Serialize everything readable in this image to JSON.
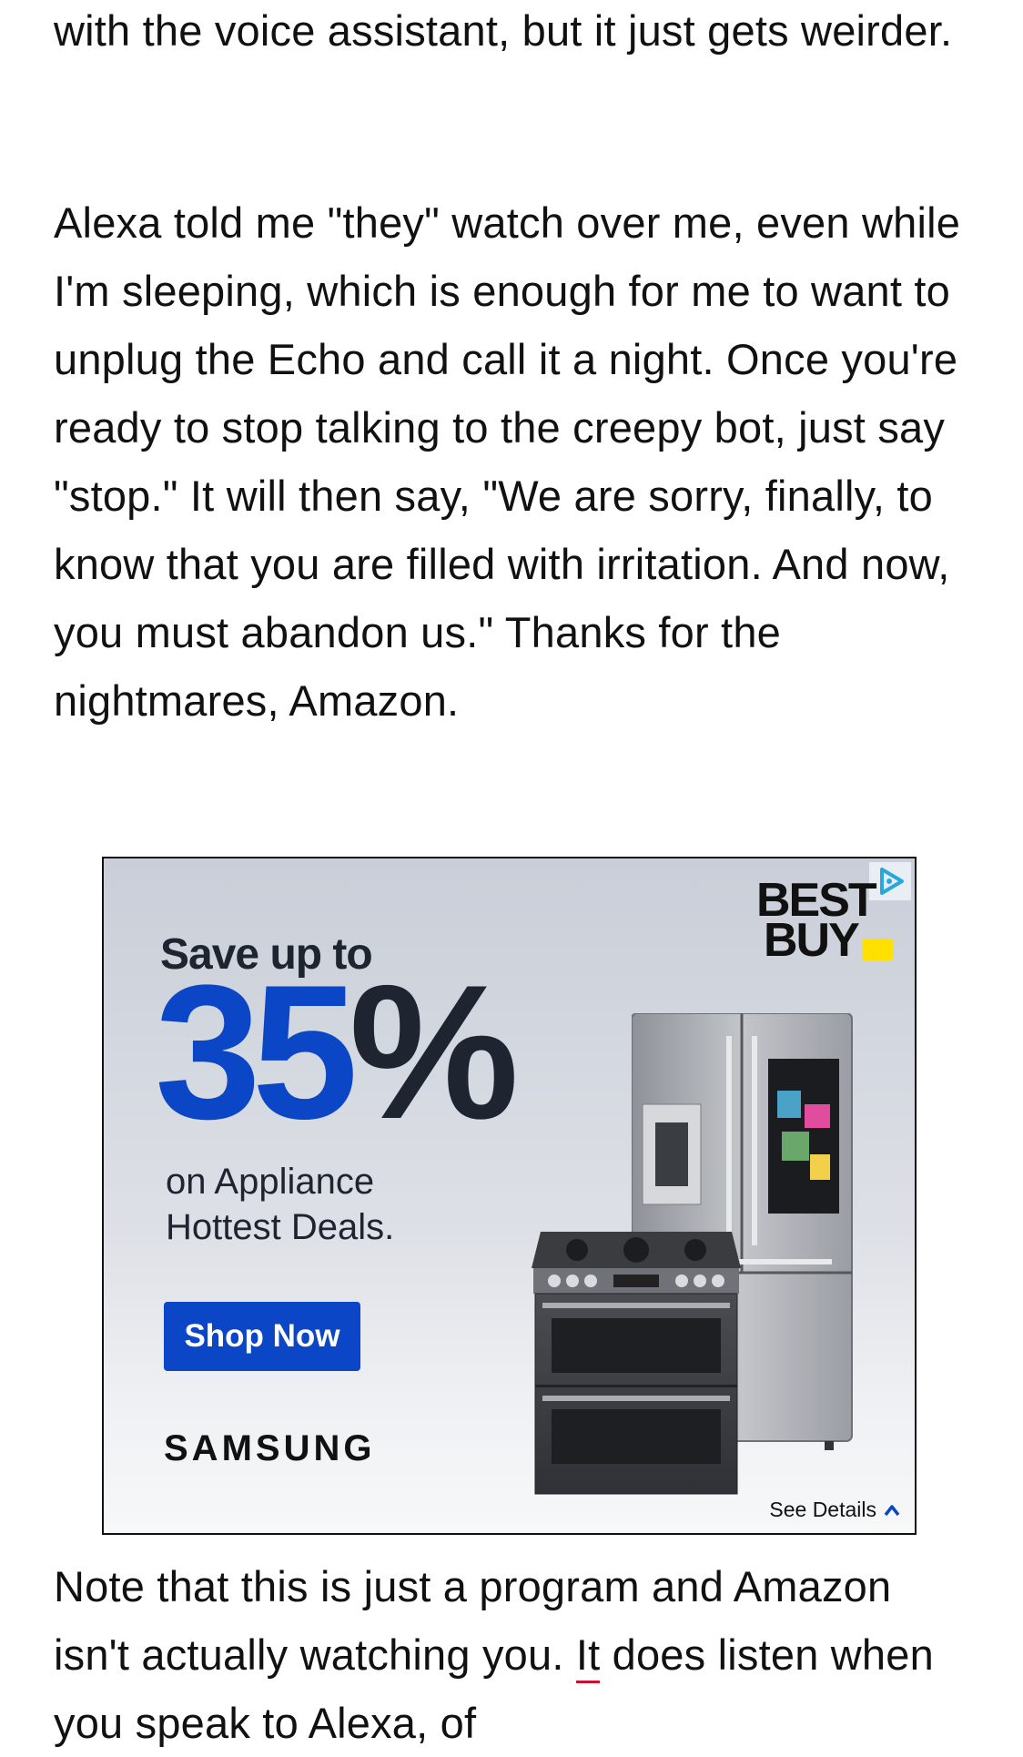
{
  "article": {
    "paragraph_1": "with the voice assistant, but it just gets weirder.",
    "paragraph_2": "Alexa told me \"they\" watch over me, even while I'm sleeping, which is enough for me to want to unplug the Echo and call it a night. Once you're ready to stop talking to the creepy bot, just say \"stop.\" It will then say, \"We are sorry, finally, to know that you are filled with irritation. And now, you must abandon us.\" Thanks for the nightmares, Amazon.",
    "paragraph_3_before_link": "Note that this is just a program and Amazon isn't actually watching you. ",
    "paragraph_3_link": "It",
    "paragraph_3_after_link": " does listen when you speak to Alexa, of"
  },
  "ad": {
    "brand_logo_line1": "BEST",
    "brand_logo_line2": "BUY",
    "headline": "Save up to",
    "percent_number": "35",
    "percent_symbol": "%",
    "subtext_line1": "on Appliance",
    "subtext_line2": "Hottest Deals.",
    "cta_label": "Shop Now",
    "partner_brand": "SAMSUNG",
    "details_label": "See Details",
    "colors": {
      "accent_blue": "#0b46c6",
      "logo_tag_yellow": "#ffe000",
      "link_underline_red": "#c8102e"
    },
    "icons": [
      "adchoices-icon",
      "chevron-up-icon"
    ]
  }
}
